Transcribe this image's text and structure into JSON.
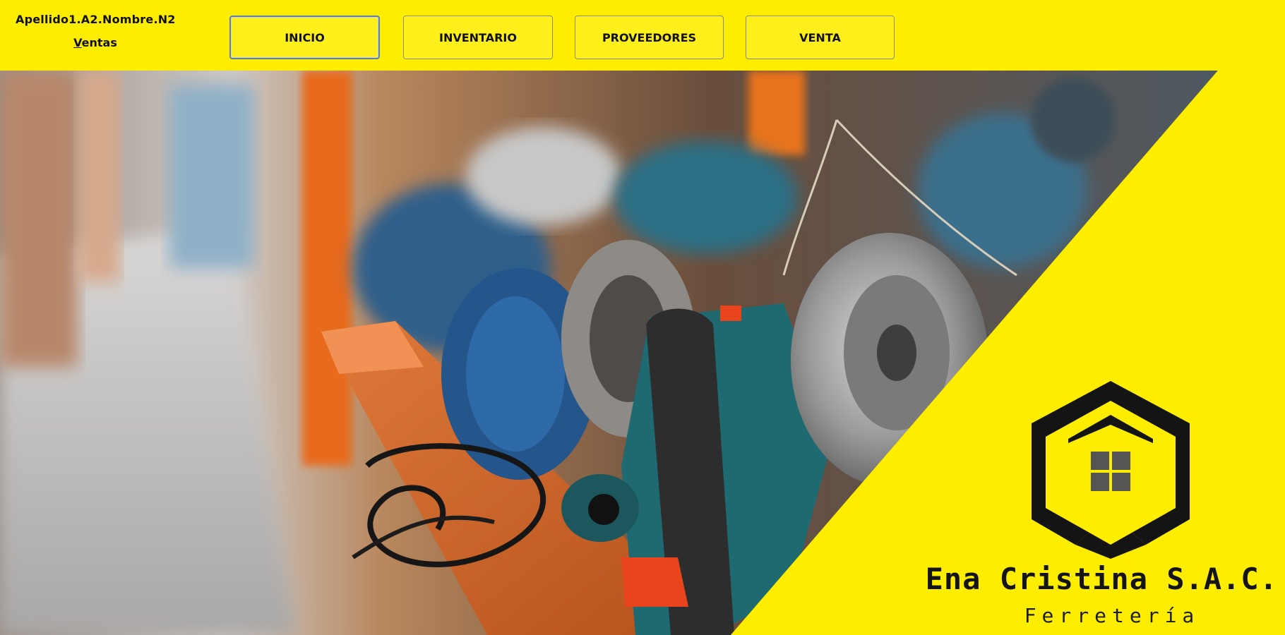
{
  "header": {
    "user": "Apellido1.A2.Nombre.N2",
    "module_accel": "V",
    "module_rest": "entas"
  },
  "nav": {
    "inicio": "INICIO",
    "inventario": "INVENTARIO",
    "proveedores": "PROVEEDORES",
    "venta": "VENTA",
    "active": "INICIO"
  },
  "brand": {
    "name": "Ena Cristina S.A.C.",
    "tagline": "Ferretería",
    "logo_icon": "house-hexagon-logo"
  },
  "hero": {
    "image_icon": "power-tools-photo"
  },
  "colors": {
    "background": "#FFED00",
    "button": "#FFF01C",
    "active_border": "#5f7fa6",
    "text": "#111111"
  }
}
